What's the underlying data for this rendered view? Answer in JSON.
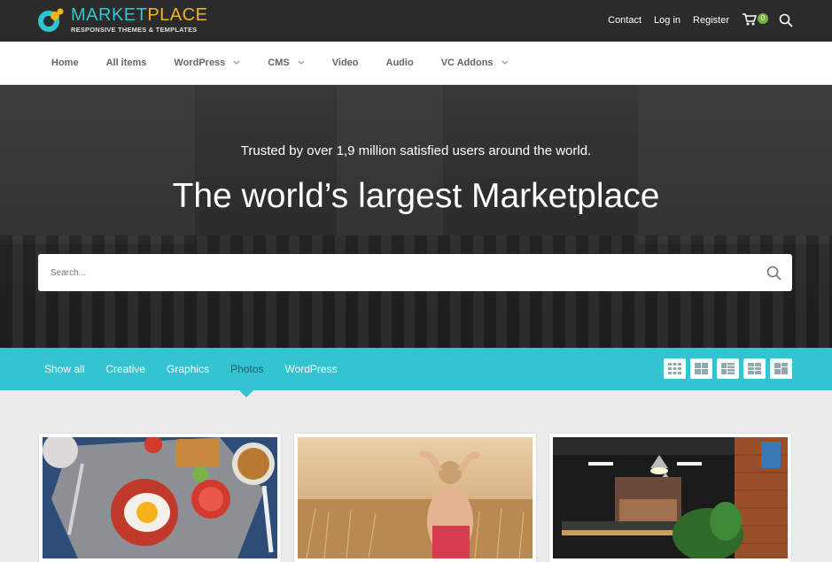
{
  "logo": {
    "title_part1": "MARKET",
    "title_part2": "PLACE",
    "tagline": "RESPONSIVE THEMES & TEMPLATES"
  },
  "toplinks": {
    "contact": "Contact",
    "login": "Log in",
    "register": "Register",
    "cart_count": "0"
  },
  "nav": {
    "items": [
      {
        "label": "Home",
        "dropdown": false
      },
      {
        "label": "All items",
        "dropdown": false
      },
      {
        "label": "WordPress",
        "dropdown": true
      },
      {
        "label": "CMS",
        "dropdown": true
      },
      {
        "label": "Video",
        "dropdown": false
      },
      {
        "label": "Audio",
        "dropdown": false
      },
      {
        "label": "VC Addons",
        "dropdown": true
      }
    ]
  },
  "hero": {
    "subtitle": "Trusted by over 1,9 million satisfied users around the world.",
    "title": "The world’s largest Marketplace",
    "search_placeholder": "Search..."
  },
  "filters": {
    "items": [
      "Show all",
      "Creative",
      "Graphics",
      "Photos",
      "WordPress"
    ],
    "active": "Photos"
  },
  "colors": {
    "accent": "#33c3d1",
    "topbar": "#2b2b2b",
    "logo_blue": "#2ec5d3",
    "logo_orange": "#f3b41c",
    "badge": "#7bb342"
  },
  "icons": [
    "cart-icon",
    "search-icon",
    "chevron-down-icon",
    "grid-layout-icon"
  ]
}
